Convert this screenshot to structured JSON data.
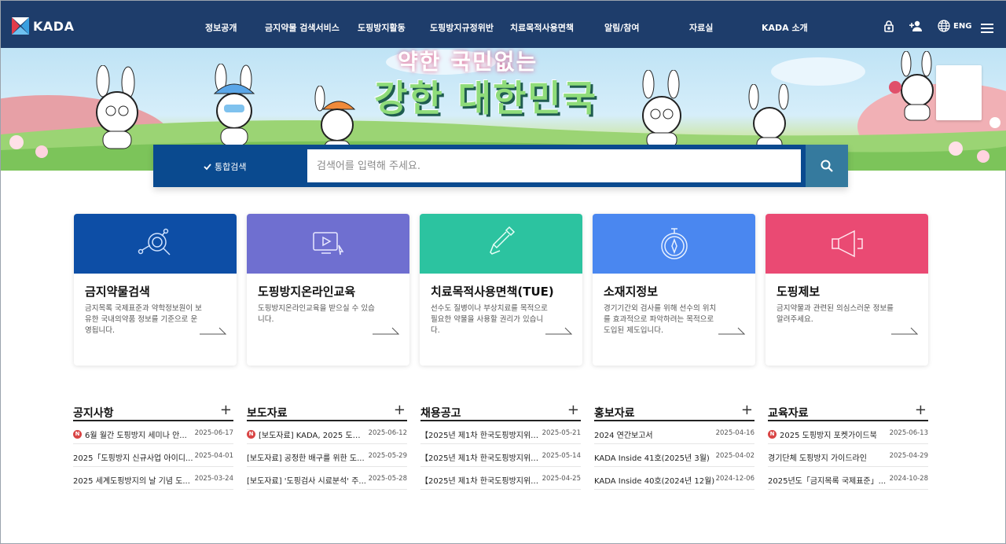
{
  "header": {
    "logo_text": "KADA",
    "nav": [
      "정보공개",
      "금지약물 검색서비스",
      "도핑방지활동",
      "도핑방지규정위반",
      "치료목적사용면책",
      "알림/참여",
      "자료실",
      "KADA 소개"
    ],
    "lang_label": "ENG",
    "icons": [
      "lock-icon",
      "user-add-icon",
      "globe-icon",
      "menu-icon"
    ]
  },
  "banner": {
    "headline_small": "약한 국민없는",
    "headline": "강한 대한민국"
  },
  "search": {
    "tab_label": "통합검색",
    "placeholder": "검색어를 입력해 주세요."
  },
  "cards": [
    {
      "title": "금지약물검색",
      "desc": "금지목록 국제표준과 약학정보원이 보유한 국내의약품 정보를 기준으로 운영됩니다.",
      "color": "#0d4ea6",
      "icon": "search-icon"
    },
    {
      "title": "도핑방지온라인교육",
      "desc": "도핑방지온라인교육을 받으실 수 있습니다.",
      "color": "#6f6fd0",
      "icon": "video-play-icon"
    },
    {
      "title": "치료목적사용면책(TUE)",
      "desc": "선수도 질병이나 부상치료를 목적으로 필요한 약물을 사용할 권리가 있습니다.",
      "color": "#2cc3a0",
      "icon": "dropper-icon"
    },
    {
      "title": "소재지정보",
      "desc": "경기기간외 검사를 위해 선수의 위치를 효과적으로 파악하려는 목적으로 도입된 제도입니다.",
      "color": "#4a87f0",
      "icon": "compass-icon"
    },
    {
      "title": "도핑제보",
      "desc": "금지약물과 관련된 의심스러운 정보를 알려주세요.",
      "color": "#ea4a73",
      "icon": "megaphone-icon"
    }
  ],
  "boards": [
    {
      "title": "공지사항",
      "rows": [
        {
          "text": "6월 월간 도핑방지 세미나 안...",
          "date": "2025-06-17",
          "new": true
        },
        {
          "text": "2025「도핑방지 신규사업 아이디...",
          "date": "2025-04-01",
          "new": false
        },
        {
          "text": "2025 세계도핑방지의 날 기념 도...",
          "date": "2025-03-24",
          "new": false
        }
      ]
    },
    {
      "title": "보도자료",
      "rows": [
        {
          "text": "[보도자료] KADA, 2025 도핑...",
          "date": "2025-06-12",
          "new": true
        },
        {
          "text": "[보도자료] 공정한 배구를 위한 도...",
          "date": "2025-05-29",
          "new": false
        },
        {
          "text": "[보도자료] '도핑검사 시료분석' 주...",
          "date": "2025-05-28",
          "new": false
        }
      ]
    },
    {
      "title": "채용공고",
      "rows": [
        {
          "text": "【2025년 제1차 한국도핑방지위원...",
          "date": "2025-05-21",
          "new": false
        },
        {
          "text": "【2025년 제1차 한국도핑방지위원...",
          "date": "2025-05-14",
          "new": false
        },
        {
          "text": "【2025년 제1차 한국도핑방지위원...",
          "date": "2025-04-25",
          "new": false
        }
      ]
    },
    {
      "title": "홍보자료",
      "rows": [
        {
          "text": "2024 연간보고서",
          "date": "2025-04-16",
          "new": false
        },
        {
          "text": "KADA Inside 41호(2025년 3월)",
          "date": "2025-04-02",
          "new": false
        },
        {
          "text": "KADA Inside 40호(2024년 12월)",
          "date": "2024-12-06",
          "new": false
        }
      ]
    },
    {
      "title": "교육자료",
      "rows": [
        {
          "text": "2025 도핑방지 포켓가이드북",
          "date": "2025-06-13",
          "new": true
        },
        {
          "text": "경기단체 도핑방지 가이드라인",
          "date": "2025-04-29",
          "new": false
        },
        {
          "text": "2025년도「금지목록 국제표준」...",
          "date": "2024-10-28",
          "new": false
        }
      ]
    }
  ],
  "plus_symbol": "+",
  "new_symbol": "N"
}
